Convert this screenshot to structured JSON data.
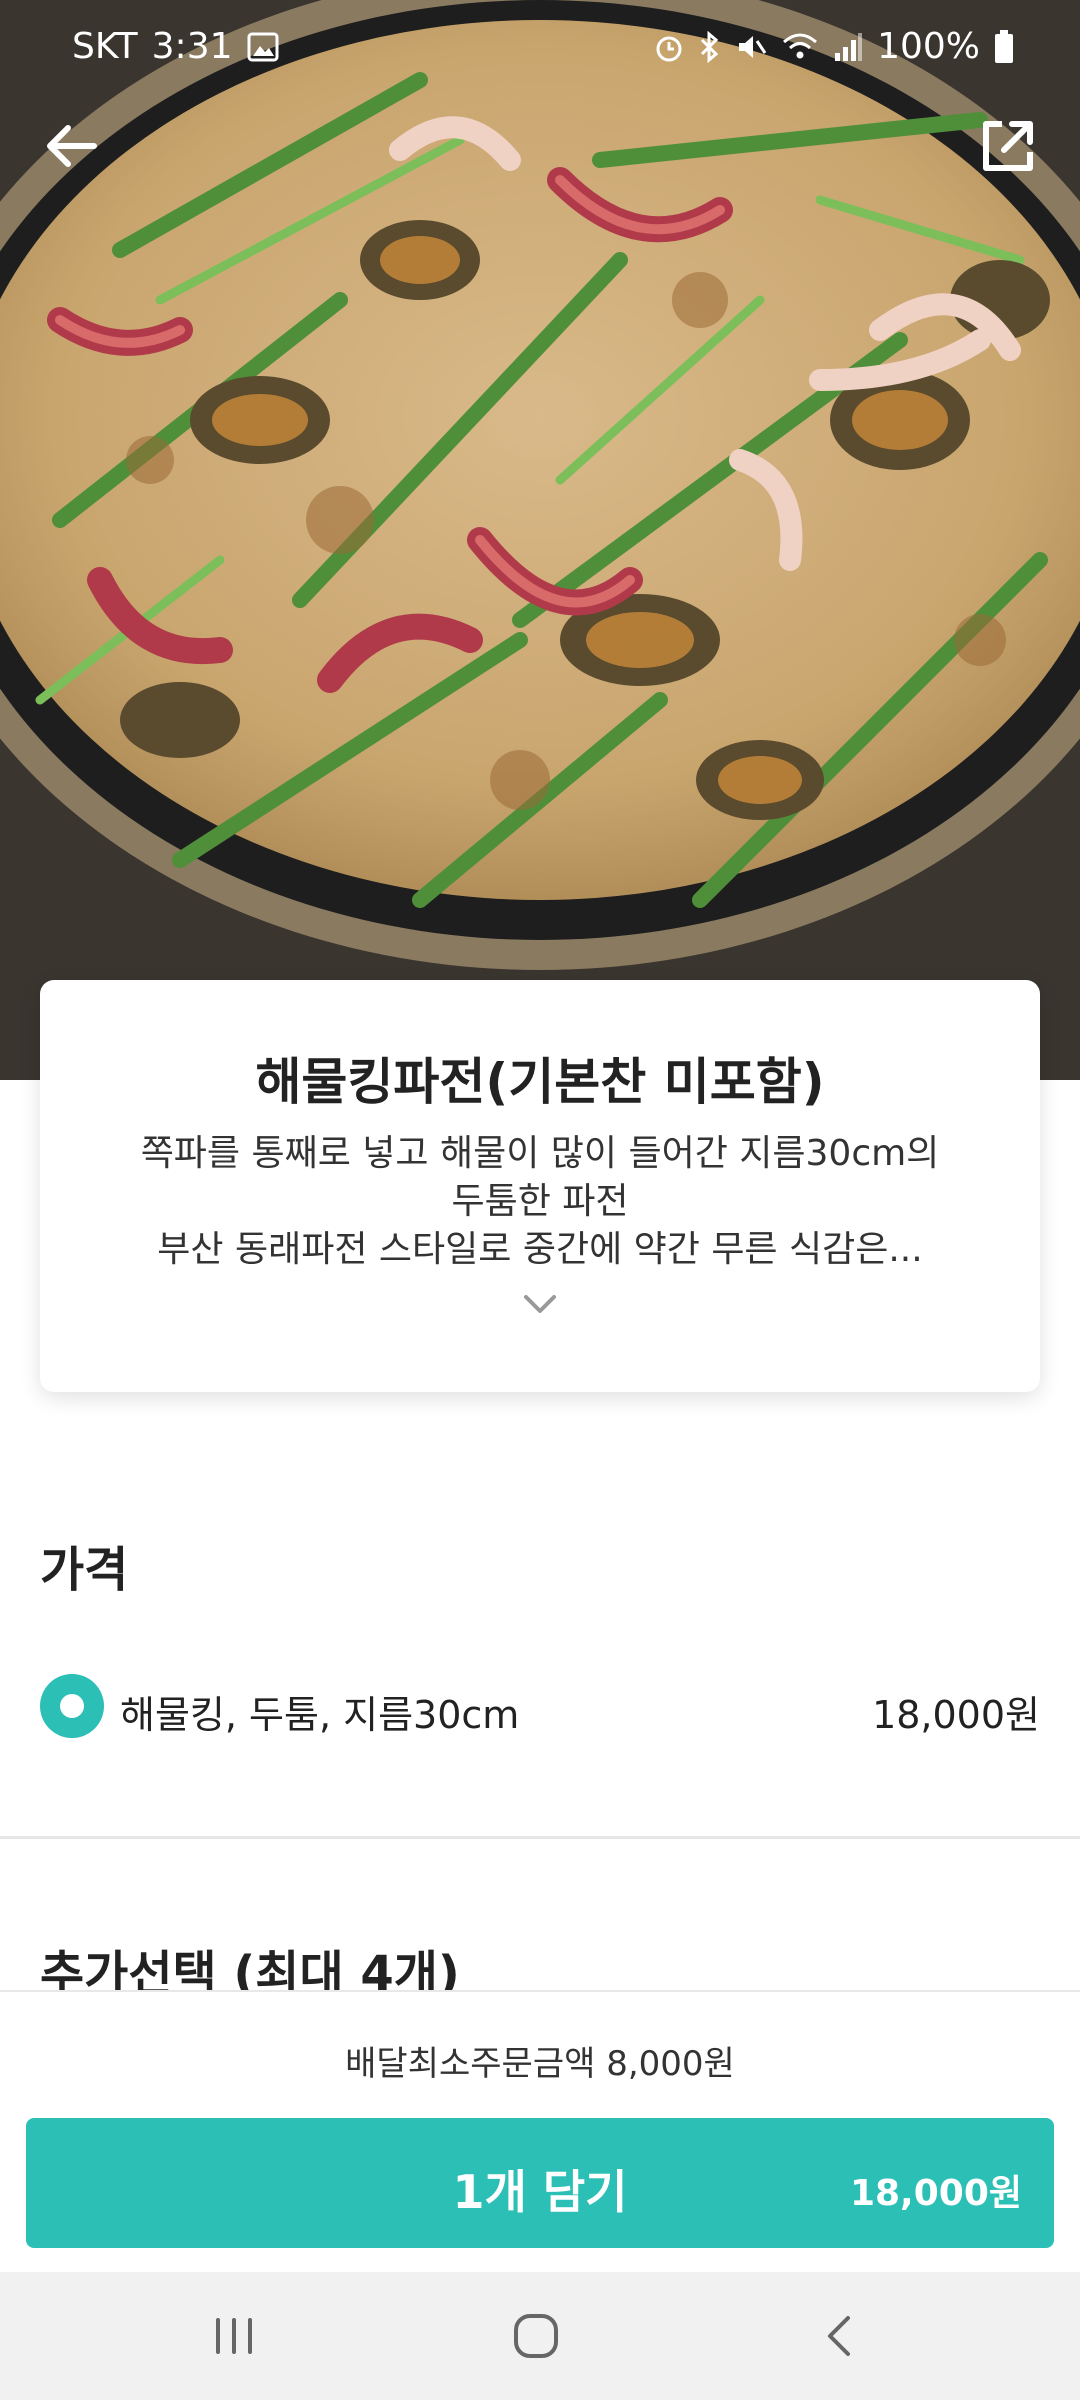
{
  "status_bar": {
    "carrier": "SKT",
    "time": "3:31",
    "battery": "100%",
    "icons": [
      "image-icon",
      "alarm-icon",
      "bluetooth-icon",
      "mute-icon",
      "wifi-icon",
      "signal-icon",
      "battery-icon"
    ]
  },
  "header": {
    "back_icon": "arrow-left-icon",
    "share_icon": "share-icon"
  },
  "menu": {
    "title": "해물킹파전(기본찬 미포함)",
    "description_lines": [
      "쪽파를 통째로 넣고 해물이 많이 들어간 지름30cm의",
      "두툼한 파전",
      "부산 동래파전 스타일로 중간에 약간 무른 식감은..."
    ],
    "expand_icon": "chevron-down-icon"
  },
  "price_section": {
    "title": "가격",
    "options": [
      {
        "label": "해물킹, 두툼, 지름30cm",
        "price": "18,000원",
        "selected": true
      }
    ]
  },
  "extra_section": {
    "title": "추가선택 (최대 4개)"
  },
  "order_bar": {
    "min_order_text": "배달최소주문금액 8,000원",
    "add_button_label": "1개 담기",
    "add_button_price": "18,000원"
  },
  "nav_bar": {
    "icons": [
      "recents-icon",
      "home-icon",
      "back-icon"
    ]
  },
  "colors": {
    "accent": "#2bbfb6",
    "text": "#222222",
    "divider": "#e6e6e6",
    "nav_bg": "#f1f1f1"
  }
}
